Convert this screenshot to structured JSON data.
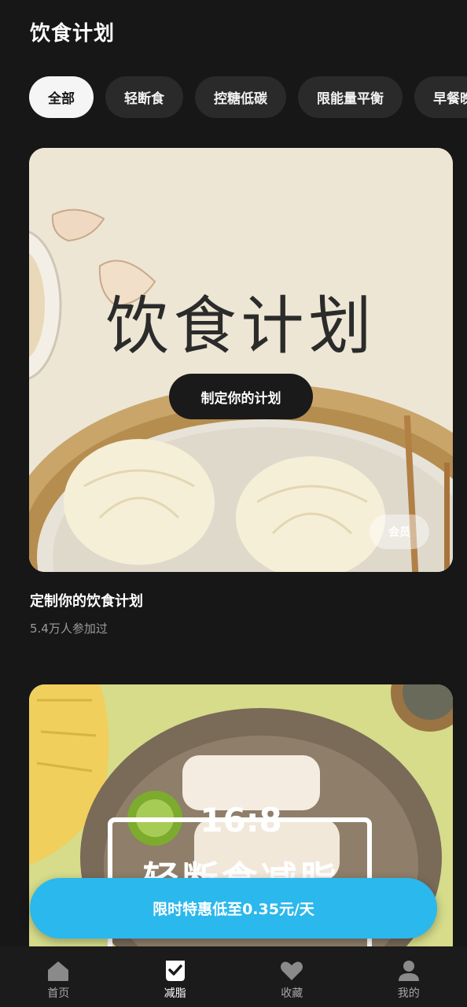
{
  "header": {
    "title": "饮食计划"
  },
  "tabs": [
    {
      "label": "全部",
      "active": true
    },
    {
      "label": "轻断食"
    },
    {
      "label": "控糖低碳"
    },
    {
      "label": "限能量平衡"
    },
    {
      "label": "早餐晚"
    }
  ],
  "cards": [
    {
      "banner_text": "饮食计划",
      "button_label": "制定你的计划",
      "badge": "会员",
      "title": "定制你的饮食计划",
      "subtitle": "5.4万人参加过"
    },
    {
      "banner_top": "16:8",
      "banner_main": "轻断食减脂"
    }
  ],
  "promo": {
    "label": "限时特惠低至0.35元/天",
    "color": "#2bb8ec"
  },
  "tabbar": [
    {
      "label": "首页",
      "icon": "home-icon"
    },
    {
      "label": "减脂",
      "icon": "check-shield-icon",
      "active": true
    },
    {
      "label": "收藏",
      "icon": "heart-icon"
    },
    {
      "label": "我的",
      "icon": "person-icon"
    }
  ]
}
